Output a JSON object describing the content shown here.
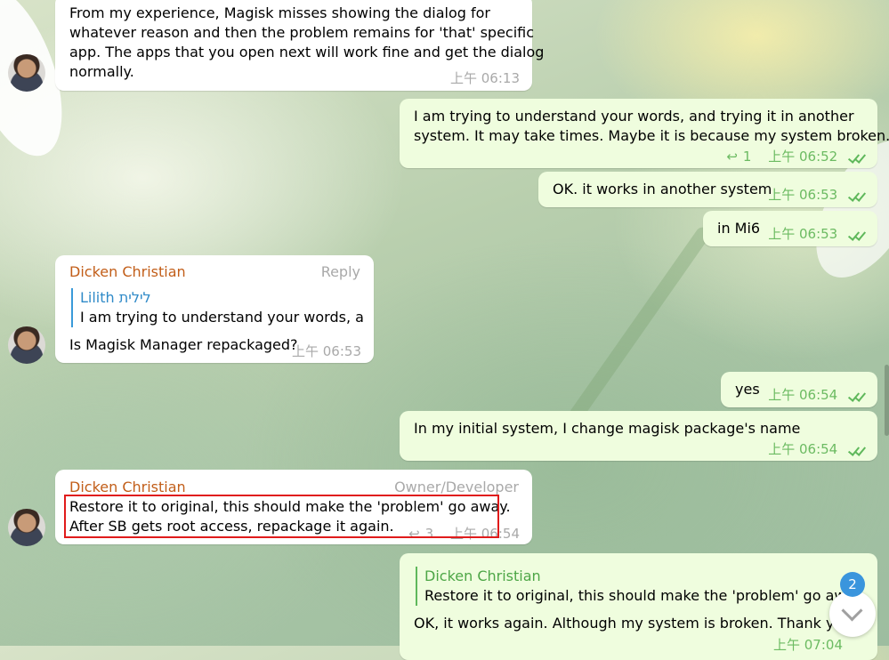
{
  "messages": [
    {
      "lines": [
        "From my experience, Magisk misses showing the dialog for",
        "whatever reason and then the problem remains for 'that' specific",
        "app. The apps that you open next will work fine and get the dialog",
        "normally."
      ],
      "time": "上午 06:13"
    },
    {
      "lines": [
        "I am trying to understand your words, and trying it in another",
        "system. It may take times. Maybe it is because my system broken."
      ],
      "replies": "1",
      "time": "上午 06:52"
    },
    {
      "text": "OK. it works in another system",
      "time": "上午 06:53"
    },
    {
      "text": "in Mi6",
      "time": "上午 06:53"
    },
    {
      "sender": "Dicken Christian",
      "action": "Reply",
      "quote_name": "Lilith לילית",
      "quote_text": "I am trying to understand your words, a...",
      "text": "Is Magisk Manager repackaged?",
      "time": "上午 06:53"
    },
    {
      "text": "yes",
      "time": "上午 06:54"
    },
    {
      "text": "In my initial system, I change magisk package's name",
      "time": "上午 06:54"
    },
    {
      "sender": "Dicken Christian",
      "role": "Owner/Developer",
      "lines": [
        "Restore it to original, this should make the 'problem' go away.",
        "After SB gets root access, repackage it again."
      ],
      "replies": "3",
      "time": "上午 06:54"
    },
    {
      "quote_name": "Dicken Christian",
      "quote_text": "Restore it to original, this should make the 'problem' go away.",
      "text": "OK, it works again. Although my system is broken. Thank you!",
      "time": "上午 07:04"
    }
  ],
  "unread_badge": "2",
  "colors": {
    "sender": "#c25e19",
    "outgoing": "#effdde",
    "incoming": "#ffffff",
    "badge": "#3a95dd",
    "highlight": "#e01b1b"
  }
}
